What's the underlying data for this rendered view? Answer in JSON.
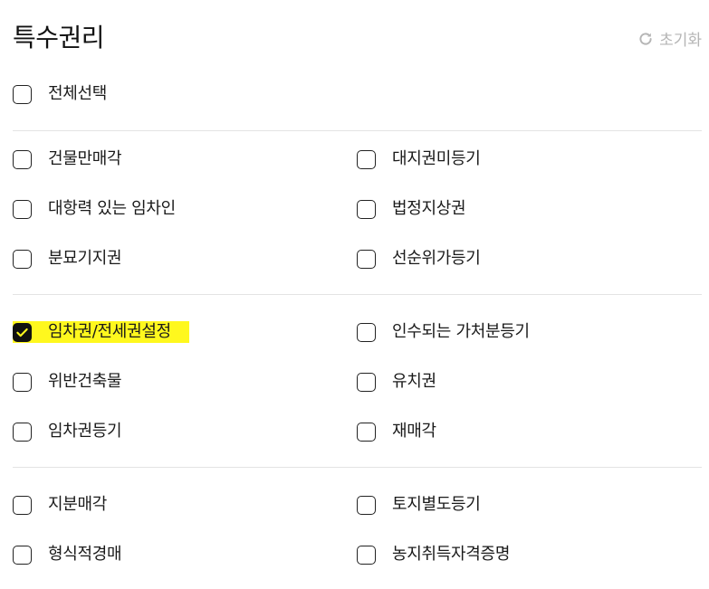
{
  "header": {
    "title": "특수권리",
    "reset_label": "초기화"
  },
  "select_all": {
    "label": "전체선택",
    "checked": false
  },
  "groups": [
    {
      "rows": [
        [
          {
            "label": "건물만매각",
            "checked": false
          },
          {
            "label": "대지권미등기",
            "checked": false
          }
        ],
        [
          {
            "label": "대항력 있는 임차인",
            "checked": false
          },
          {
            "label": "법정지상권",
            "checked": false
          }
        ],
        [
          {
            "label": "분묘기지권",
            "checked": false
          },
          {
            "label": "선순위가등기",
            "checked": false
          }
        ]
      ]
    },
    {
      "rows": [
        [
          {
            "label": "임차권/전세권설정",
            "checked": true,
            "highlight": true
          },
          {
            "label": "인수되는 가처분등기",
            "checked": false
          }
        ],
        [
          {
            "label": "위반건축물",
            "checked": false
          },
          {
            "label": "유치권",
            "checked": false
          }
        ],
        [
          {
            "label": "임차권등기",
            "checked": false
          },
          {
            "label": "재매각",
            "checked": false
          }
        ]
      ]
    },
    {
      "rows": [
        [
          {
            "label": "지분매각",
            "checked": false
          },
          {
            "label": "토지별도등기",
            "checked": false
          }
        ],
        [
          {
            "label": "형식적경매",
            "checked": false
          },
          {
            "label": "농지취득자격증명",
            "checked": false
          }
        ]
      ]
    }
  ],
  "colors": {
    "highlight": "#fff81e",
    "checkbox_border": "#222222",
    "divider": "#e3e3e3",
    "reset_text": "#b5b5b5"
  },
  "icons": {
    "reset": "refresh-icon",
    "check": "checkmark-icon"
  }
}
